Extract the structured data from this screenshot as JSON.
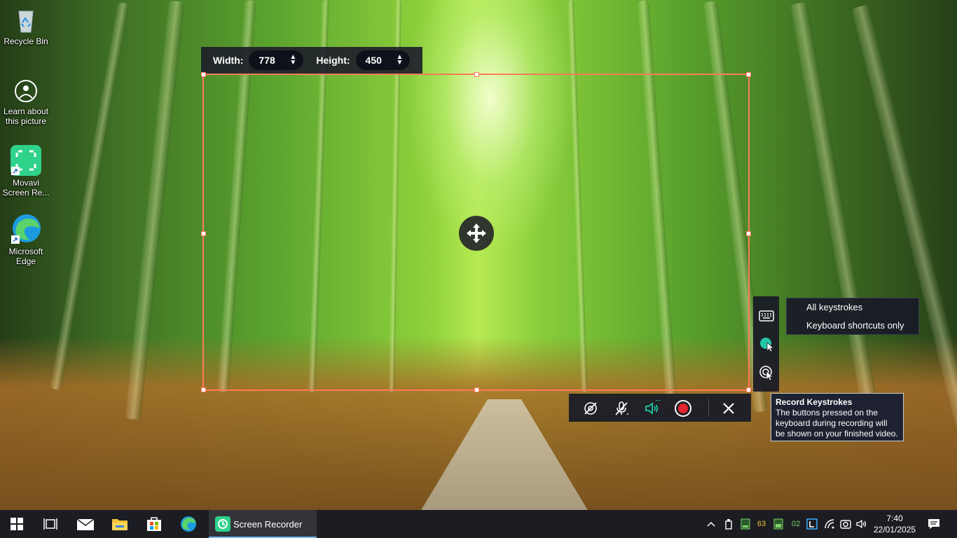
{
  "desktop_icons": [
    {
      "label": "Recycle Bin",
      "icon": "recycle-bin-icon"
    },
    {
      "label": "Learn about this picture",
      "icon": "learn-picture-icon"
    },
    {
      "label": "Movavi Screen Re...",
      "icon": "movavi-icon"
    },
    {
      "label": "Microsoft Edge",
      "icon": "edge-icon"
    }
  ],
  "size_bar": {
    "width_label": "Width:",
    "width_value": "778",
    "height_label": "Height:",
    "height_value": "450"
  },
  "keystroke_menu": {
    "items": [
      "All keystrokes",
      "Keyboard shortcuts only"
    ]
  },
  "tooltip": {
    "title": "Record Keystrokes",
    "body": "The buttons pressed on the keyboard during recording will be shown on your finished video."
  },
  "taskbar": {
    "active_app": "Screen Recorder",
    "time": "7:40",
    "date": "22/01/2025",
    "tray_badge_1": "63",
    "tray_badge_2": "02"
  },
  "colors": {
    "selection": "#ff7b5a",
    "record": "#e3262f",
    "accent": "#21c7a8",
    "taskbar": "#1c1d22"
  }
}
